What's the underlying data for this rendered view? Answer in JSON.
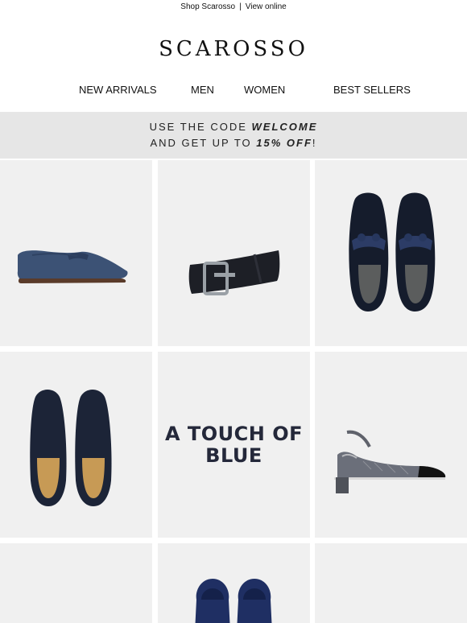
{
  "topbar": {
    "shop_link": "Shop Scarosso",
    "separator": "|",
    "view_link": "View online"
  },
  "brand": {
    "logo": "SCAROSSO"
  },
  "nav": [
    {
      "label": "NEW ARRIVALS"
    },
    {
      "label": "MEN"
    },
    {
      "label": "WOMEN"
    },
    {
      "label": "BEST SELLERS"
    }
  ],
  "promo": {
    "line1_prefix": "USE THE CODE ",
    "line1_code": "WELCOME",
    "line2_prefix": "AND GET UP TO ",
    "line2_amount": "15% OFF",
    "line2_suffix": "!"
  },
  "grid": {
    "feature_line1": "A TOUCH OF",
    "feature_line2": "BLUE",
    "products": [
      {
        "icon": "blue-suede-loafer-icon"
      },
      {
        "icon": "black-suede-belt-icon"
      },
      {
        "icon": "tassel-loafers-pair-icon"
      },
      {
        "icon": "navy-loafers-top-view-icon"
      },
      {
        "icon": "tweed-slingback-icon"
      },
      {
        "icon": "product-placeholder"
      },
      {
        "icon": "velvet-slippers-icon"
      },
      {
        "icon": "product-placeholder"
      }
    ]
  },
  "colors": {
    "background": "#ffffff",
    "tile": "#f0f0f0",
    "promo_band": "#e6e6e6",
    "navy": "#24283a"
  }
}
